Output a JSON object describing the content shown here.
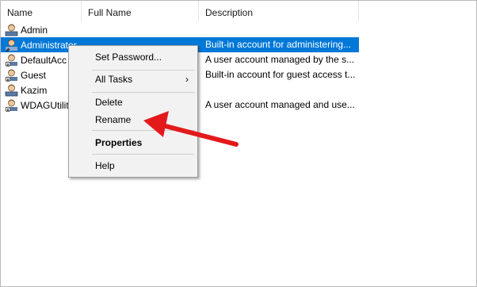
{
  "columns": {
    "name": "Name",
    "full_name": "Full Name",
    "description": "Description"
  },
  "users": [
    {
      "name": "Admin",
      "full_name": "",
      "description": "",
      "selected": false
    },
    {
      "name": "Administrator",
      "full_name": "",
      "description": "Built-in account for administering...",
      "selected": true
    },
    {
      "name": "DefaultAcc",
      "full_name": "",
      "description": "A user account managed by the s...",
      "selected": false
    },
    {
      "name": "Guest",
      "full_name": "",
      "description": "Built-in account for guest access t...",
      "selected": false
    },
    {
      "name": "Kazim",
      "full_name": "",
      "description": "",
      "selected": false
    },
    {
      "name": "WDAGUtilit",
      "full_name": "",
      "description": "A user account managed and use...",
      "selected": false
    }
  ],
  "context_menu": {
    "set_password": "Set Password...",
    "all_tasks": "All Tasks",
    "all_tasks_arrow": "›",
    "delete": "Delete",
    "rename": "Rename",
    "properties": "Properties",
    "help": "Help"
  },
  "colors": {
    "selection": "#0078d7",
    "annotation_arrow": "#e3191c"
  },
  "icons": {
    "user": "user-account-icon",
    "annotation": "red-arrow-annotation"
  }
}
